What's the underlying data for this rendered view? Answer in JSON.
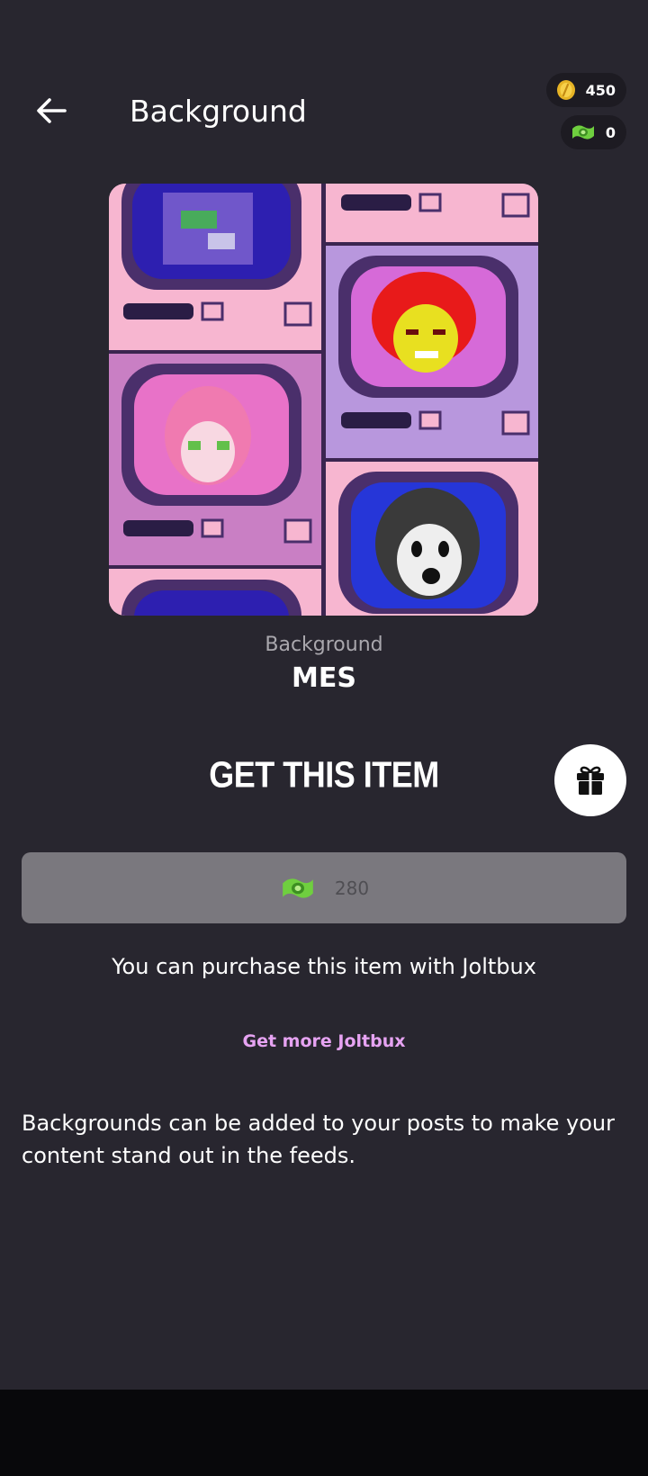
{
  "header": {
    "title": "Background",
    "back_icon": "arrow-left-icon"
  },
  "balances": {
    "coins": {
      "icon": "gold-coin-icon",
      "value": "450"
    },
    "joltbux": {
      "icon": "joltbux-icon",
      "value": "0"
    }
  },
  "item": {
    "kind": "Background",
    "name": "MES",
    "preview_image": "retro-tv-screens-artwork"
  },
  "purchase": {
    "heading": "GET THIS ITEM",
    "gift_icon": "gift-icon",
    "price_icon": "joltbux-icon",
    "price": "280",
    "note": "You can purchase this item with Joltbux",
    "more_link": "Get more Joltbux"
  },
  "description": "Backgrounds can be added to your posts to make your content stand out in the feeds.",
  "colors": {
    "background": "#28262f",
    "accent_link": "#e6a3f2",
    "button_disabled": "#7a787e",
    "coin": "#e6b325",
    "joltbux": "#6fcf3f"
  }
}
